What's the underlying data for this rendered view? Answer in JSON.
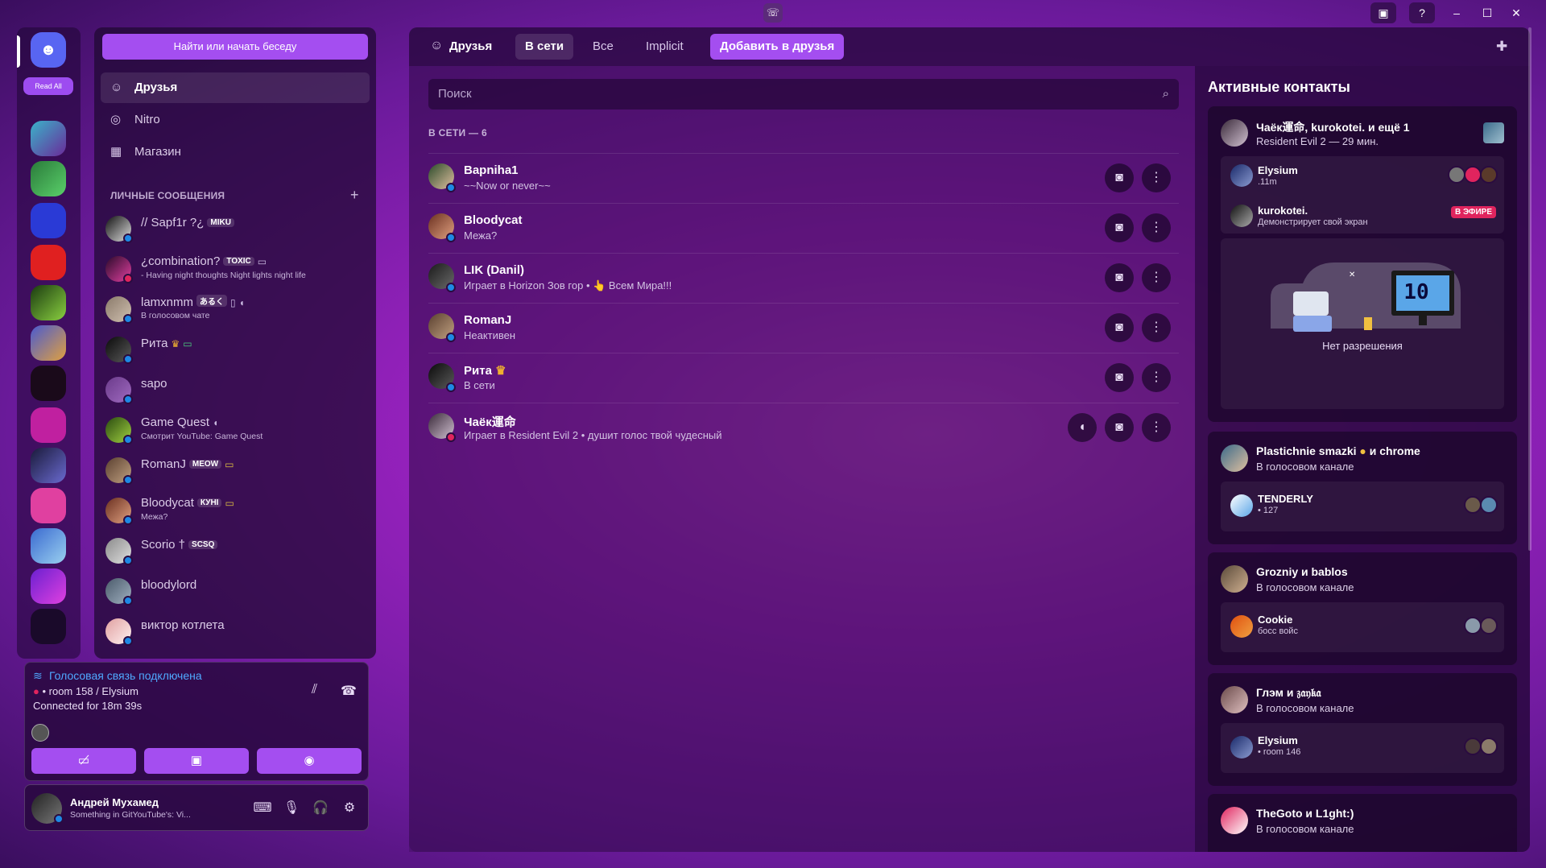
{
  "window": {
    "app_icon": "discord-icon",
    "inbox_icon": "inbox-icon",
    "help_icon": "help-icon"
  },
  "rail": {
    "read_all": "Read All"
  },
  "dm_sidebar": {
    "search_button": "Найти или начать беседу",
    "nav": [
      {
        "label": "Друзья",
        "icon": "friends-icon"
      },
      {
        "label": "Nitro",
        "icon": "nitro-icon"
      },
      {
        "label": "Магазин",
        "icon": "shop-icon"
      }
    ],
    "section_header": "ЛИЧНЫЕ СООБЩЕНИЯ",
    "items": [
      {
        "name": "// Sapf1r ?¿",
        "tag": "MIKU",
        "sub": ""
      },
      {
        "name": "¿combination?",
        "tag": "TOXIC",
        "sub": "- Having night thoughts Night lights night life"
      },
      {
        "name": "lamxnmm",
        "tag": "あるく",
        "sub": "В голосовом чате"
      },
      {
        "name": "Рита",
        "tag": "",
        "sub": ""
      },
      {
        "name": "sapo",
        "tag": "",
        "sub": ""
      },
      {
        "name": "Game Quest",
        "tag": "",
        "sub": "Смотрит YouTube: Game Quest"
      },
      {
        "name": "RomanJ",
        "tag": "MEOW",
        "sub": ""
      },
      {
        "name": "Bloodycat",
        "tag": "КУНІ",
        "sub": "Межа?"
      },
      {
        "name": "Scorio †",
        "tag": "SCSQ",
        "sub": ""
      },
      {
        "name": "bloodylord",
        "tag": "",
        "sub": ""
      },
      {
        "name": "виктор котлета",
        "tag": "",
        "sub": ""
      }
    ]
  },
  "voice": {
    "title": "Голосовая связь подключена",
    "channel": "room 158 / Elysium",
    "connected_label": "Connected for 18m  39s"
  },
  "user": {
    "name": "Андрей Мухамед",
    "status": "Something in GitYouTube's: Vi..."
  },
  "header": {
    "title": "Друзья",
    "tabs": [
      "В сети",
      "Все",
      "Implicit"
    ],
    "add_friend": "Добавить в друзья"
  },
  "friends": {
    "search_placeholder": "Поиск",
    "section": "В СЕТИ — 6",
    "rows": [
      {
        "name": "Bapniha1",
        "status": "~~Now or never~~",
        "color": "#1e88e5"
      },
      {
        "name": "Bloodycat",
        "status": "Межа?",
        "color": "#1e88e5"
      },
      {
        "name": "LIK (Danil)",
        "status": "Играет в Horizon Зов гор • 👆 Всем Мира!!!",
        "color": "#1e88e5"
      },
      {
        "name": "RomanJ",
        "status": "Неактивен",
        "color": "#1e88e5"
      },
      {
        "name": "Рита",
        "status": "В сети",
        "color": "#1e88e5"
      },
      {
        "name": "Чаёк運命",
        "status": "Играет в Resident Evil 2 • душит голос твой чудесный",
        "color": "#e0245e"
      }
    ]
  },
  "active": {
    "title": "Активные контакты",
    "cards": [
      {
        "title": "Чаёк運命, kurokotei. и ещё 1",
        "sub": "Resident Evil 2 — 29 мин.",
        "inner": [
          {
            "name": "Elysium",
            "sub": ".11m"
          },
          {
            "name": "kurokotei.",
            "sub": "Демонстрирует свой экран",
            "badge": "В ЭФИРЕ"
          }
        ],
        "no_permission": "Нет разрешения"
      },
      {
        "title": "Plastichnie smazki",
        "title_suffix": "и chrome",
        "sub": "В голосовом канале",
        "inner": [
          {
            "name": "TENDERLY",
            "sub": "• 127"
          }
        ]
      },
      {
        "title": "Grozniy и bablos",
        "sub": "В голосовом канале",
        "inner": [
          {
            "name": "Cookie",
            "sub": "босс войс"
          }
        ]
      },
      {
        "title": "Глэм и 𝔷𝔞𝔶𝔨𝔞",
        "sub": "В голосовом канале",
        "inner": [
          {
            "name": "Elysium",
            "sub": "• room 146"
          }
        ]
      },
      {
        "title": "TheGoto и L1ght:)",
        "sub": "В голосовом канале"
      }
    ],
    "countdown": "10"
  }
}
